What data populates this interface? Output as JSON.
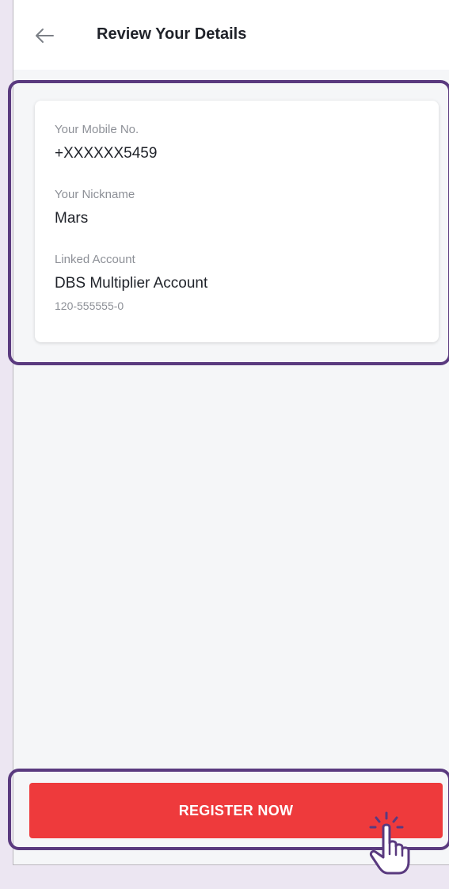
{
  "header": {
    "title": "Review Your Details",
    "back_icon": "arrow-left-icon"
  },
  "details": {
    "mobile": {
      "label": "Your Mobile No.",
      "value": "+XXXXXX5459"
    },
    "nickname": {
      "label": "Your Nickname",
      "value": "Mars"
    },
    "account": {
      "label": "Linked Account",
      "value": "DBS Multiplier Account",
      "number": "120-555555-0"
    }
  },
  "actions": {
    "register_label": "REGISTER NOW"
  },
  "colors": {
    "primary": "#ee3a3c",
    "highlight": "#5a3a7f",
    "text": "#1f2229",
    "muted": "#8d9097"
  }
}
